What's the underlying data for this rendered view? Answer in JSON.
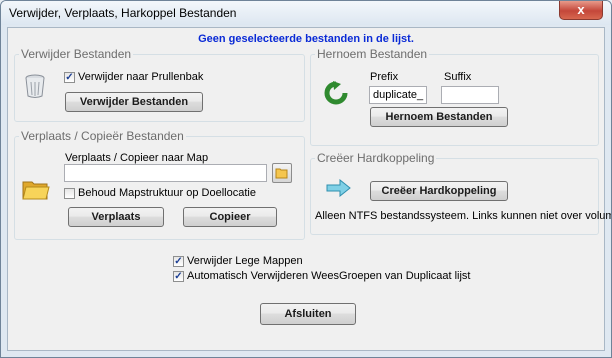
{
  "window": {
    "title": "Verwijder, Verplaats, Harkoppel Bestanden",
    "close_glyph": "x"
  },
  "status_message": "Geen geselecteerde bestanden in de lijst.",
  "delete_group": {
    "legend": "Verwijder Bestanden",
    "recycle_label": "Verwijder naar Prullenbak",
    "recycle_checked": true,
    "button": "Verwijder Bestanden",
    "icon": "trash-bin-icon"
  },
  "rename_group": {
    "legend": "Hernoem Bestanden",
    "prefix_label": "Prefix",
    "prefix_value": "duplicate_",
    "suffix_label": "Suffix",
    "suffix_value": "",
    "button": "Hernoem Bestanden",
    "icon": "rename-arrow-icon"
  },
  "move_group": {
    "legend": "Verplaats / Copieër Bestanden",
    "target_label": "Verplaats / Copieer naar Map",
    "target_value": "",
    "keep_structure_label": "Behoud Mapstruktuur op Doellocatie",
    "keep_structure_checked": false,
    "move_button": "Verplaats",
    "copy_button": "Copieer",
    "icon": "folder-icon"
  },
  "hardlink_group": {
    "legend": "Creëer Hardkoppeling",
    "button": "Creëer Hardkoppeling",
    "note": "Alleen NTFS bestandssysteem.  Links kunnen niet over volumes",
    "icon": "link-arrow-icon"
  },
  "options": {
    "remove_empty_label": "Verwijder Lege Mappen",
    "remove_empty_checked": true,
    "auto_remove_label": "Automatisch Verwijderen WeesGroepen van Duplicaat lijst",
    "auto_remove_checked": true
  },
  "close_button": "Afsluiten",
  "colors": {
    "status_text": "#0a2ad6",
    "legend_text": "#6d6d6d",
    "group_border": "#d5dfe5"
  }
}
